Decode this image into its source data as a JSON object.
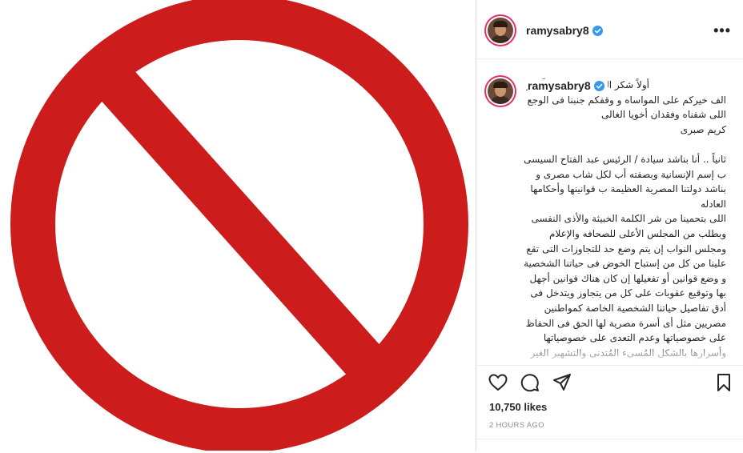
{
  "post": {
    "author": "ramysabry8",
    "caption_username": "ramysabry8",
    "caption_lead": "أولاً شكر الله سعيكم جميعاً كتر",
    "caption_body": "الف خيركم على المواساه و وقفكم جنبنا فى الوجع\nاللى شفناه وفقدان أخويا الغالى\nكريم صبرى\n\nثانياً .. أنا بناشد سيادة / الرئيس عبد الفتاح السيسى\nب إسم الإنسانية وبصفته أب لكل شاب مصرى و\nبناشد دولتنا المصرية العظيمة ب قوانينها وأحكامها\nالعادله\nاللى بتحمينا من شر الكلمة الخبيثة والأذى النفسى\nوبطلب من المجلس الأعلى للصحافه والإعلام\nومجلس النواب إن يتم وضع حد للتجاوزات التى تقع\nعلينا من كل من إستباح الخوض فى حياتنا الشخصية\nو وضع قوانين أو تفعيلها إن كان هناك قوانين أجهل\nبها وتوقيع عقوبات على كل من يتجاوز ويتدخل فى\nأدق تفاصيل حياتنا الشخصية الخاصة كمواطنين\nمصريين مثل أى أسرة مصرية لها الحق فى الحفاظ\nعلى خصوصياتها وعدم التعدى على خصوصياتها\nوأسرارها بالشكل المُسىء المُتدنى والتشهير الغير\nقانونى الذى تعرضنا له",
    "likes": "10,750 likes",
    "timestamp": "2 HOURS AGO"
  },
  "icons": {
    "verified": "verified-badge-icon",
    "more": "more-options-icon",
    "like": "heart-icon",
    "comment": "comment-icon",
    "share": "share-icon",
    "save": "bookmark-icon",
    "media": "prohibition-sign-icon"
  },
  "more_glyph": "•••",
  "colors": {
    "prohibition_red": "#cc1c1c",
    "verified_blue": "#3897f0",
    "story_ring": "#e1306c"
  }
}
